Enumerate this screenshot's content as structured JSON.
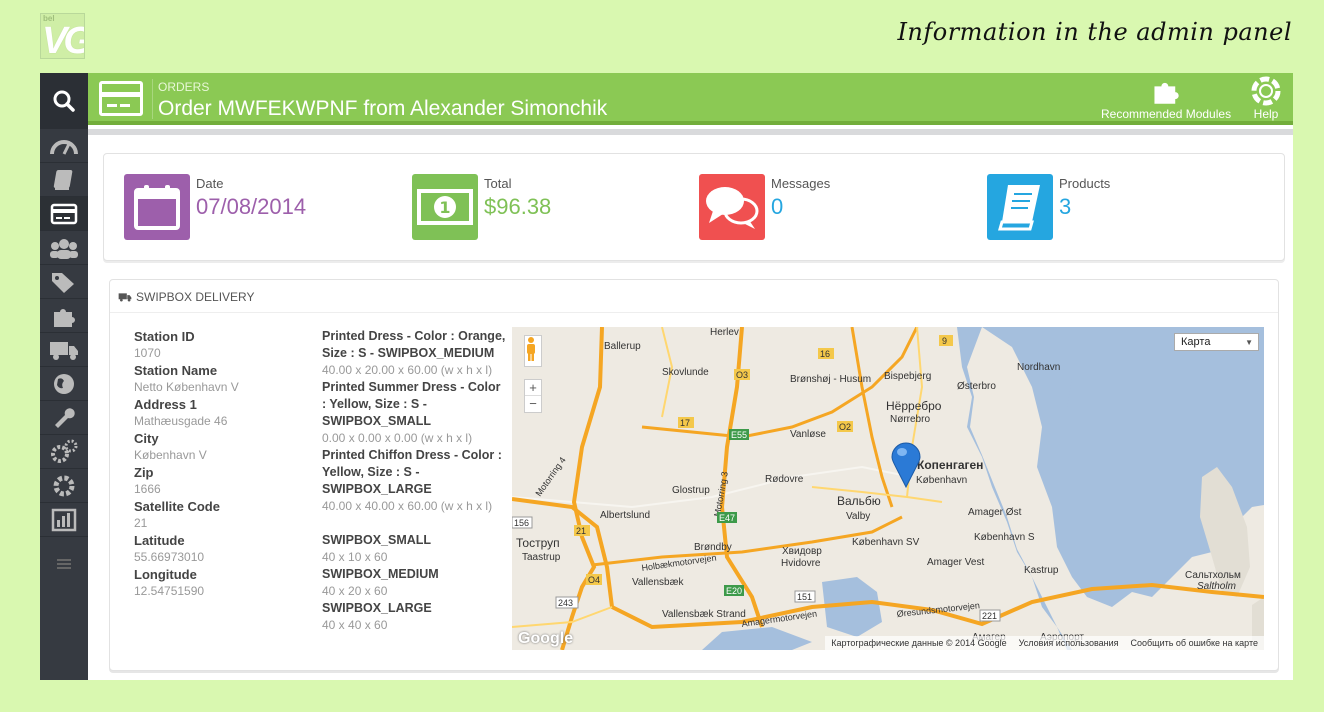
{
  "caption": "Information in the admin panel",
  "logo": {
    "small": "bel",
    "big": "VG"
  },
  "header": {
    "breadcrumb": "ORDERS",
    "title": "Order MWFEKWPNF from Alexander Simonchik",
    "recommended_label": "Recommended Modules",
    "help_label": "Help"
  },
  "kpis": [
    {
      "label": "Date",
      "value": "07/08/2014",
      "color": "#9d5fab",
      "icon": "calendar-icon"
    },
    {
      "label": "Total",
      "value": "$96.38",
      "color": "#7fc156",
      "icon": "money-icon"
    },
    {
      "label": "Messages",
      "value": "0",
      "color": "#f05050",
      "icon": "chat-icon"
    },
    {
      "label": "Products",
      "value": "3",
      "color": "#25a6e0",
      "icon": "book-icon"
    }
  ],
  "delivery": {
    "title": "SWIPBOX DELIVERY",
    "station": [
      {
        "key": "Station ID",
        "value": "1070"
      },
      {
        "key": "Station Name",
        "value": "Netto København V"
      },
      {
        "key": "Address 1",
        "value": "Mathæusgade 46"
      },
      {
        "key": "City",
        "value": "København V"
      },
      {
        "key": "Zip",
        "value": "1666"
      },
      {
        "key": "Satellite Code",
        "value": "21"
      },
      {
        "key": "Latitude",
        "value": "55.66973010"
      },
      {
        "key": "Longitude",
        "value": "12.54751590"
      }
    ],
    "products": [
      {
        "name": "Printed Dress - Color : Orange, Size : S - SWIPBOX_MEDIUM",
        "dims": "40.00 x 20.00 x 60.00 (w x h x l)"
      },
      {
        "name": "Printed Summer Dress - Color : Yellow, Size : S - SWIPBOX_SMALL",
        "dims": "0.00 x 0.00 x 0.00 (w x h x l)"
      },
      {
        "name": "Printed Chiffon Dress - Color : Yellow, Size : S - SWIPBOX_LARGE",
        "dims": "40.00 x 40.00 x 60.00 (w x h x l)"
      }
    ],
    "boxes": [
      {
        "name": "SWIPBOX_SMALL",
        "dims": "40 x 10 x 60"
      },
      {
        "name": "SWIPBOX_MEDIUM",
        "dims": "40 x 20 x 60"
      },
      {
        "name": "SWIPBOX_LARGE",
        "dims": "40 x 40 x 60"
      }
    ]
  },
  "map": {
    "type_select": "Карта",
    "zoom_in": "+",
    "zoom_out": "−",
    "logo": "Google",
    "attribution": "Картографические данные © 2014 Google",
    "terms": "Условия использования",
    "report": "Сообщить об ошибке на карте",
    "labels": [
      "Herlev",
      "Ballerup",
      "Skovlunde",
      "Brønshøj - Husum",
      "Bispebjerg",
      "Østerbro",
      "Nordhavn",
      "Нёрребро",
      "Nørrebro",
      "Vanløse",
      "Glostrup",
      "Rødovre",
      "Albertslund",
      "Вальбю",
      "Valby",
      "Тоструп",
      "Taastrup",
      "Brøndby",
      "Хвидовр",
      "Hvidovre",
      "København SV",
      "Amager Øst",
      "København S",
      "Amager Vest",
      "Kastrup",
      "Vallensbæk",
      "Vallensbæk Strand",
      "Сальтхольм",
      "Saltholm",
      "Аэропорт",
      "Амагер",
      "Копенгаген",
      "København",
      "Holbækmotorvejen",
      "Amagermotorvejen",
      "Øresundsmotorvejen",
      "Motorring 4",
      "Motorring 3"
    ],
    "road_codes": [
      "9",
      "16",
      "O3",
      "17",
      "E55",
      "O2",
      "E47",
      "21",
      "156",
      "O4",
      "243",
      "E20",
      "151",
      "221"
    ]
  },
  "colors": {
    "header": "#8bc954",
    "sidebar": "#363a41",
    "background": "#d9f8b0"
  }
}
